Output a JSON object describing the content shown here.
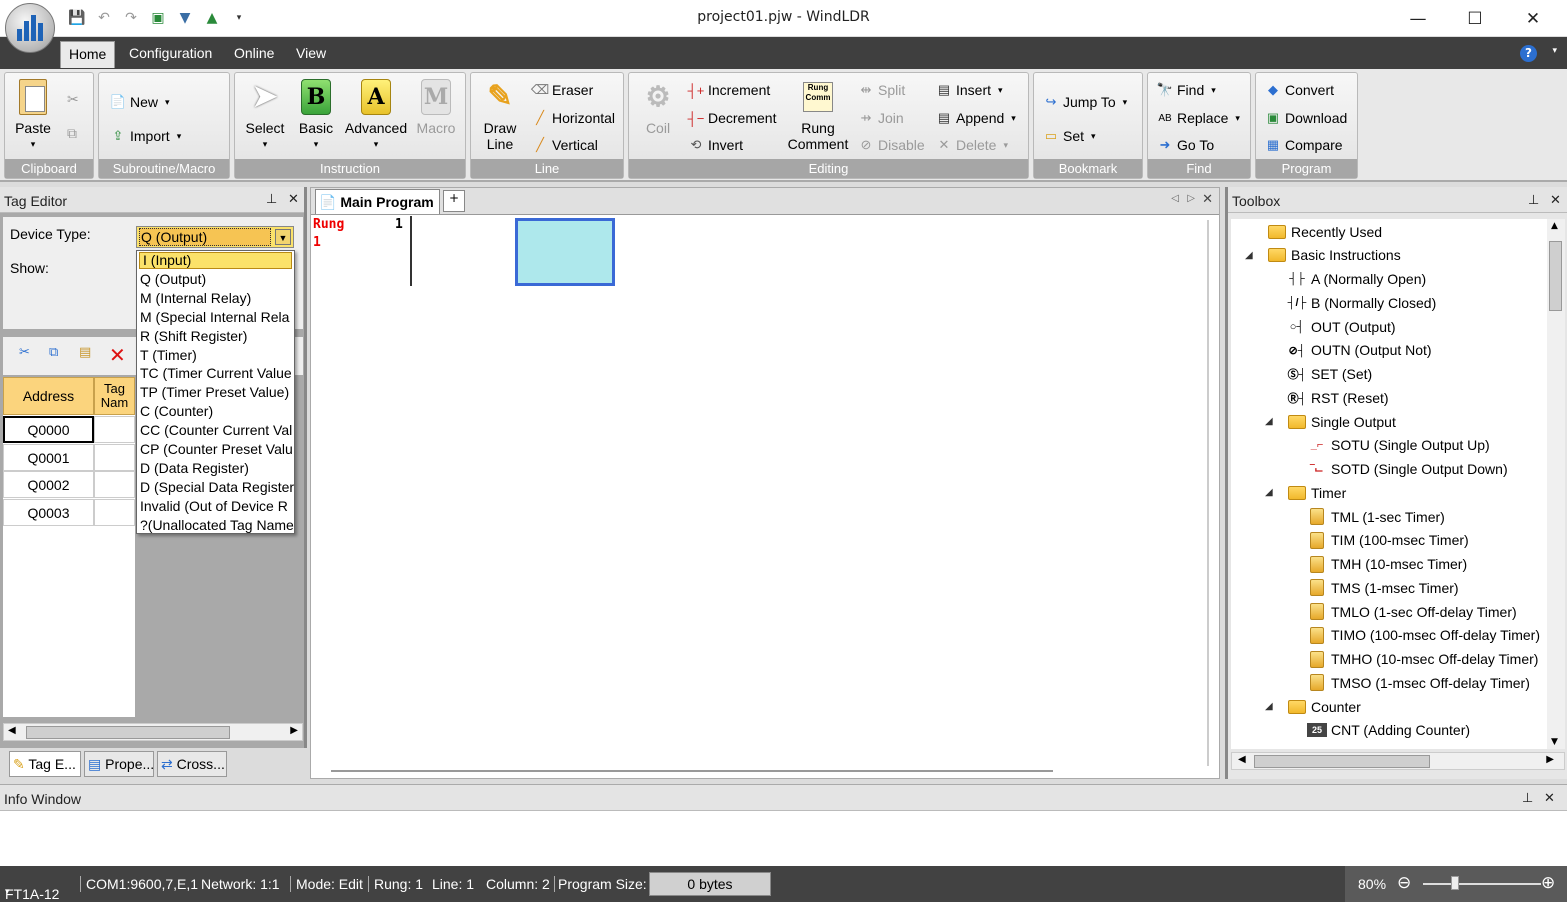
{
  "window": {
    "title": "project01.pjw - WindLDR",
    "minimize": "—",
    "maximize": "☐",
    "close": "✕"
  },
  "ribbon_tabs": [
    "Home",
    "Configuration",
    "Online",
    "View"
  ],
  "help": "?",
  "groups": {
    "clipboard": {
      "label": "Clipboard",
      "paste": "Paste"
    },
    "subroutine": {
      "label": "Subroutine/Macro",
      "new": "New",
      "import": "Import"
    },
    "instruction": {
      "label": "Instruction",
      "select": "Select",
      "basic": "Basic",
      "advanced": "Advanced",
      "macro": "Macro",
      "basic_glyph": "B",
      "advanced_glyph": "A",
      "macro_glyph": "M"
    },
    "line": {
      "label": "Line",
      "draw1": "Draw",
      "draw2": "Line",
      "eraser": "Eraser",
      "horizontal": "Horizontal",
      "vertical": "Vertical"
    },
    "editing": {
      "label": "Editing",
      "coil": "Coil",
      "increment": "Increment",
      "decrement": "Decrement",
      "invert": "Invert",
      "rung1": "Rung",
      "rung2": "Comment",
      "split": "Split",
      "join": "Join",
      "disable": "Disable",
      "insert": "Insert",
      "append": "Append",
      "delete": "Delete"
    },
    "bookmark": {
      "label": "Bookmark",
      "jump": "Jump To",
      "set": "Set"
    },
    "find": {
      "label": "Find",
      "find": "Find",
      "replace": "Replace",
      "goto": "Go To"
    },
    "program": {
      "label": "Program",
      "convert": "Convert",
      "download": "Download",
      "compare": "Compare"
    }
  },
  "tag_editor": {
    "title": "Tag Editor",
    "device_type_label": "Device Type:",
    "show_label": "Show:",
    "device_type_value": "Q (Output)",
    "options": [
      "I (Input)",
      "Q (Output)",
      "M (Internal Relay)",
      "M (Special Internal Rela",
      "R (Shift Register)",
      "T (Timer)",
      "TC (Timer Current Value",
      "TP (Timer Preset Value)",
      "C (Counter)",
      "CC (Counter Current Val",
      "CP (Counter Preset Valu",
      "D (Data Register)",
      "D (Special Data Register",
      "Invalid (Out of Device R",
      "?(Unallocated Tag Name"
    ],
    "columns": {
      "address": "Address",
      "tag1": "Tag",
      "tag2": "Nam"
    },
    "rows": [
      "Q0000",
      "Q0001",
      "Q0002",
      "Q0003"
    ],
    "bottom_tabs": [
      "Tag E...",
      "Prope...",
      "Cross..."
    ]
  },
  "editor": {
    "tab": "Main Program",
    "rung_label": "Rung",
    "rung_num": "1",
    "rung_index": "1"
  },
  "toolbox": {
    "title": "Toolbox",
    "items": [
      {
        "label": "Recently Used",
        "icon": "folder-icon"
      },
      {
        "label": "Basic Instructions",
        "icon": "folder-icon"
      },
      {
        "label": "A (Normally Open)",
        "icon": "contact-no-icon"
      },
      {
        "label": "B (Normally Closed)",
        "icon": "contact-nc-icon"
      },
      {
        "label": "OUT (Output)",
        "icon": "coil-icon"
      },
      {
        "label": "OUTN (Output Not)",
        "icon": "coil-not-icon"
      },
      {
        "label": "SET (Set)",
        "icon": "set-icon"
      },
      {
        "label": "RST (Reset)",
        "icon": "reset-icon"
      },
      {
        "label": "Single Output",
        "icon": "folder-icon"
      },
      {
        "label": "SOTU (Single Output Up)",
        "icon": "rising-edge-icon"
      },
      {
        "label": "SOTD (Single Output Down)",
        "icon": "falling-edge-icon"
      },
      {
        "label": "Timer",
        "icon": "folder-icon"
      },
      {
        "label": "TML (1-sec Timer)",
        "icon": "timer-icon"
      },
      {
        "label": "TIM (100-msec Timer)",
        "icon": "timer-icon"
      },
      {
        "label": "TMH (10-msec Timer)",
        "icon": "timer-icon"
      },
      {
        "label": "TMS (1-msec Timer)",
        "icon": "timer-icon"
      },
      {
        "label": "TMLO (1-sec Off-delay Timer)",
        "icon": "timer-icon"
      },
      {
        "label": "TIMO (100-msec Off-delay Timer)",
        "icon": "timer-icon"
      },
      {
        "label": "TMHO (10-msec Off-delay Timer)",
        "icon": "timer-icon"
      },
      {
        "label": "TMSO (1-msec Off-delay Timer)",
        "icon": "timer-icon"
      },
      {
        "label": "Counter",
        "icon": "folder-icon"
      },
      {
        "label": "CNT (Adding Counter)",
        "icon": "counter-icon"
      }
    ]
  },
  "info_window": {
    "title": "Info Window"
  },
  "statusbar": {
    "plc": "FT1A-12",
    "comm": "COM1:9600,7,E,1",
    "network": "Network: 1:1",
    "mode": "Mode: Edit",
    "rung": "Rung: 1",
    "line": "Line: 1",
    "column": "Column: 2",
    "psize_label": "Program Size:",
    "psize_value": "0 bytes",
    "zoom": "80%"
  },
  "colors": {
    "ribbon_tab_bg": "#3f3f3f",
    "group_label_bg": "#a6a6a6",
    "selection_yellow": "#fbe26a",
    "rung_red": "#e00000",
    "cursor_fill": "#aee8ec",
    "cursor_border": "#3a69d6"
  }
}
